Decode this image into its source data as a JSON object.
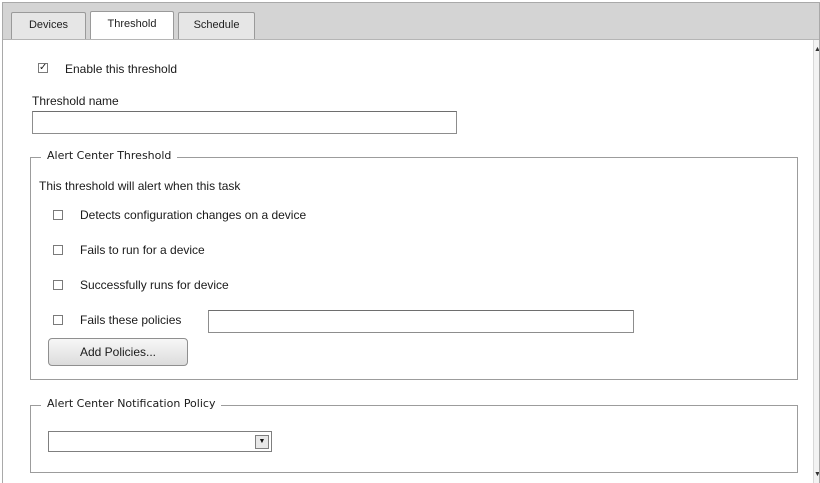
{
  "tabs": [
    {
      "label": "Devices",
      "active": false
    },
    {
      "label": "Threshold",
      "active": true
    },
    {
      "label": "Schedule",
      "active": false
    }
  ],
  "enable_threshold": {
    "label": "Enable this threshold",
    "checked": true
  },
  "threshold_name": {
    "label": "Threshold name",
    "value": ""
  },
  "alert_center_threshold": {
    "legend": "Alert Center Threshold",
    "intro": "This threshold will alert when this task",
    "options": [
      {
        "label": "Detects configuration changes on a device",
        "checked": false
      },
      {
        "label": "Fails to run for a device",
        "checked": false
      },
      {
        "label": "Successfully runs for device",
        "checked": false
      },
      {
        "label": "Fails these policies",
        "checked": false
      }
    ],
    "policies_value": "",
    "add_policies_label": "Add Policies..."
  },
  "notification_policy": {
    "legend": "Alert Center Notification Policy",
    "selected": ""
  },
  "glyphs": {
    "check": "✓",
    "dropdown": "▼",
    "scroll_up": "▲",
    "scroll_down": "▼"
  }
}
